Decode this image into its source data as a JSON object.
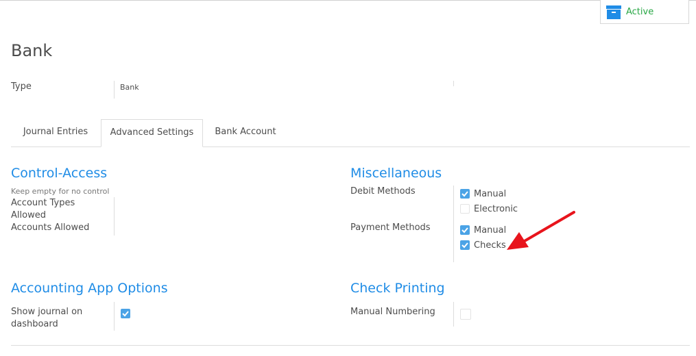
{
  "status": {
    "label": "Active",
    "icon": "archive-icon",
    "color": "#28a745"
  },
  "page": {
    "title": "Bank"
  },
  "type_field": {
    "label": "Type",
    "value": "Bank"
  },
  "tabs": [
    {
      "label": "Journal Entries",
      "active": false
    },
    {
      "label": "Advanced Settings",
      "active": true
    },
    {
      "label": "Bank Account",
      "active": false
    }
  ],
  "control_access": {
    "title": "Control-Access",
    "hint": "Keep empty for no control",
    "account_types_label": "Account Types Allowed",
    "accounts_label": "Accounts Allowed"
  },
  "misc": {
    "title": "Miscellaneous",
    "debit_label": "Debit Methods",
    "debit_methods": [
      {
        "label": "Manual",
        "checked": true
      },
      {
        "label": "Electronic",
        "checked": false
      }
    ],
    "payment_label": "Payment Methods",
    "payment_methods": [
      {
        "label": "Manual",
        "checked": true
      },
      {
        "label": "Checks",
        "checked": true
      }
    ]
  },
  "app_options": {
    "title": "Accounting App Options",
    "show_journal_label": "Show journal on dashboard",
    "show_journal_checked": true
  },
  "check_printing": {
    "title": "Check Printing",
    "manual_numbering_label": "Manual Numbering",
    "manual_numbering_checked": false
  },
  "colors": {
    "accent": "#1f8ce6",
    "checkbox": "#4ba3e6",
    "annotation_arrow": "#e8141c"
  }
}
